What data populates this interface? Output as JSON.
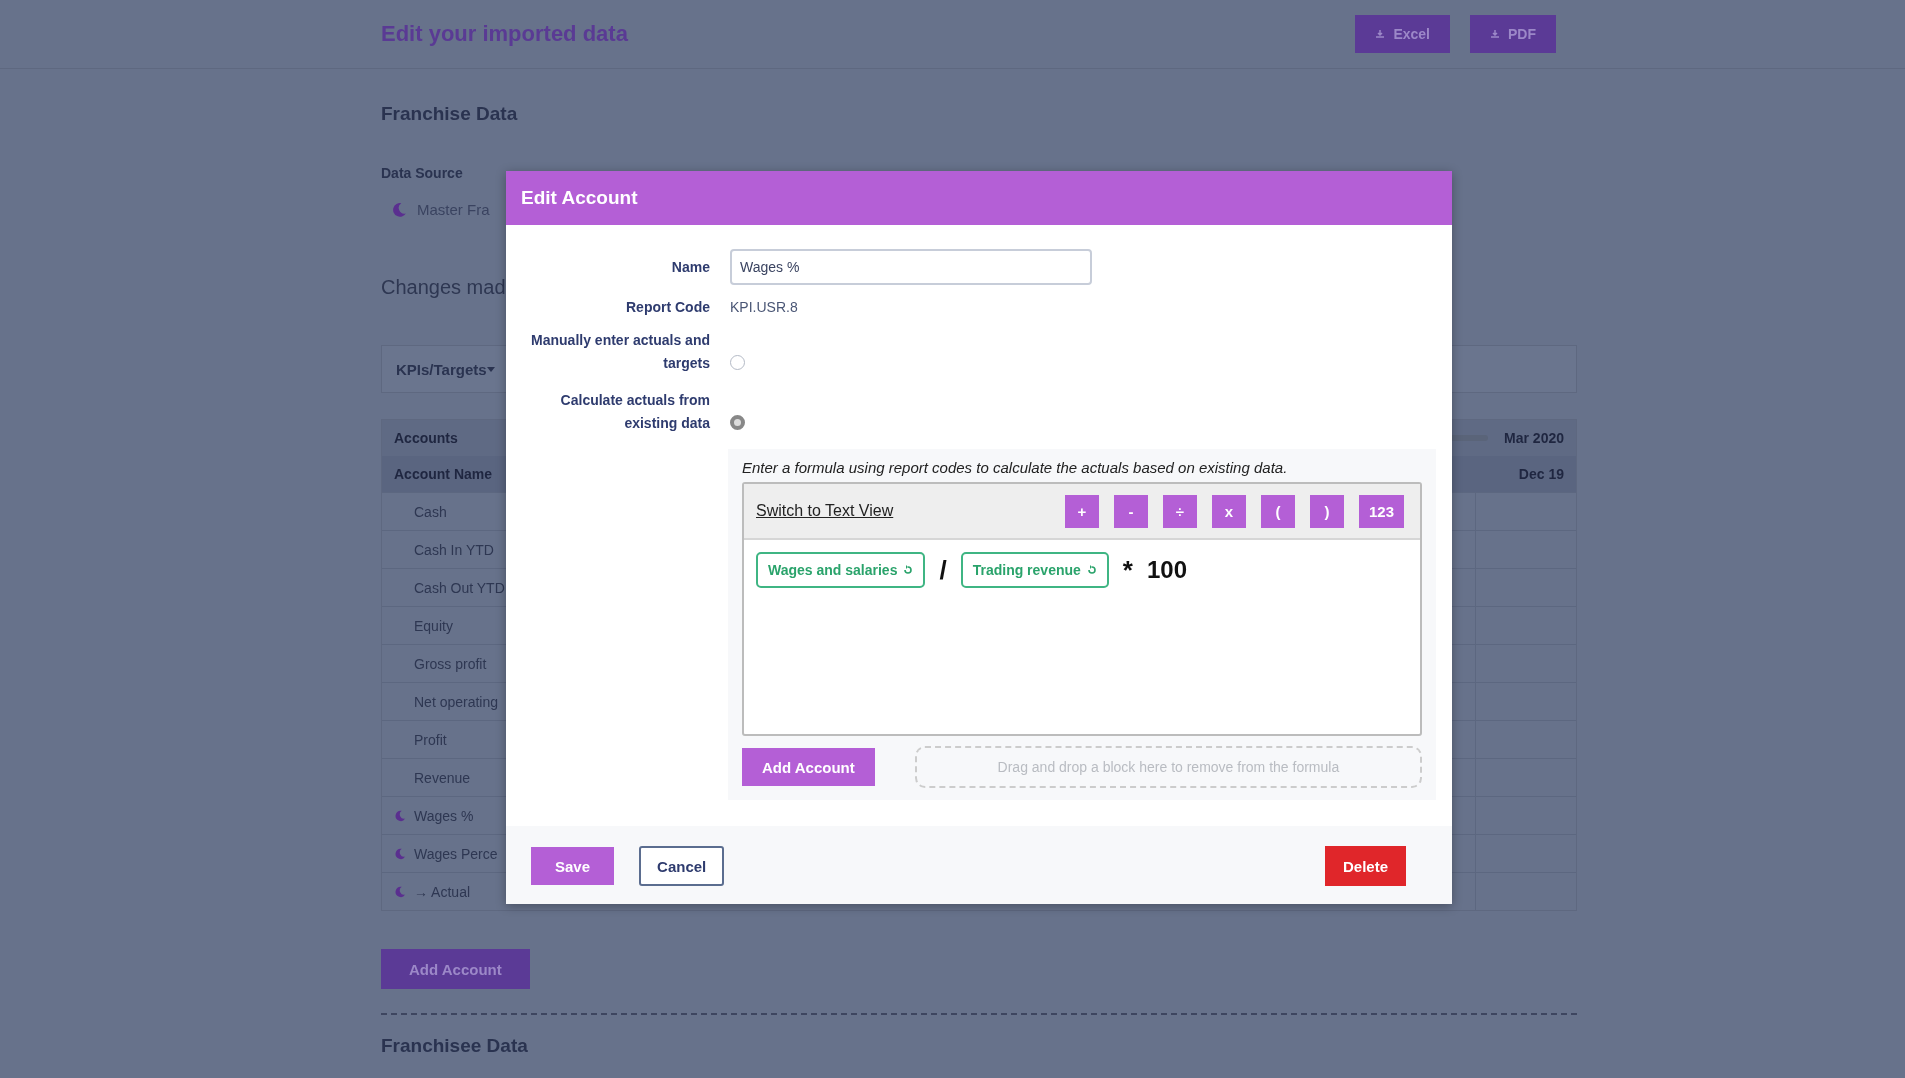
{
  "page": {
    "title": "Edit your imported data",
    "export_buttons": [
      "Excel",
      "PDF"
    ],
    "section_title": "Franchise Data",
    "data_source_label": "Data Source",
    "data_source": "Master Fra",
    "changes_text": "Changes mad",
    "tab_select": "KPIs/Targets",
    "table": {
      "group_header": "Accounts",
      "period_header": "Mar 2020",
      "column_header": "Account Name",
      "period_column": "Dec 19",
      "rows": [
        {
          "name": "Cash",
          "custom": false
        },
        {
          "name": "Cash In YTD",
          "custom": false
        },
        {
          "name": "Cash Out YTD",
          "custom": false
        },
        {
          "name": "Equity",
          "custom": false
        },
        {
          "name": "Gross profit",
          "custom": false
        },
        {
          "name": "Net operating",
          "custom": false
        },
        {
          "name": "Profit",
          "custom": false
        },
        {
          "name": "Revenue",
          "custom": false
        },
        {
          "name": "Wages %",
          "custom": true
        },
        {
          "name": "Wages Perce",
          "custom": true
        },
        {
          "name": "→ Actual",
          "custom": true
        }
      ]
    },
    "add_account": "Add Account",
    "next_section": "Franchisee Data"
  },
  "modal": {
    "title": "Edit Account",
    "name_label": "Name",
    "name_value": "Wages %",
    "report_code_label": "Report Code",
    "report_code": "KPI.USR.8",
    "options": [
      {
        "label": "Manually enter actuals and targets",
        "selected": false
      },
      {
        "label": "Calculate actuals from existing data",
        "selected": true
      }
    ],
    "formula_hint": "Enter a formula using report codes to calculate the actuals based on existing data.",
    "switch_view": "Switch to Text View",
    "operator_buttons": [
      "+",
      "-",
      "÷",
      "x",
      "(",
      ")",
      "123"
    ],
    "formula": [
      {
        "kind": "account",
        "text": "Wages and salaries"
      },
      {
        "kind": "operator",
        "text": "/"
      },
      {
        "kind": "account",
        "text": "Trading revenue"
      },
      {
        "kind": "operator",
        "text": "*"
      },
      {
        "kind": "number",
        "text": "100"
      }
    ],
    "add_account": "Add Account",
    "drop_zone": "Drag and drop a block here to remove from the formula",
    "buttons": {
      "save": "Save",
      "cancel": "Cancel",
      "delete": "Delete"
    }
  }
}
